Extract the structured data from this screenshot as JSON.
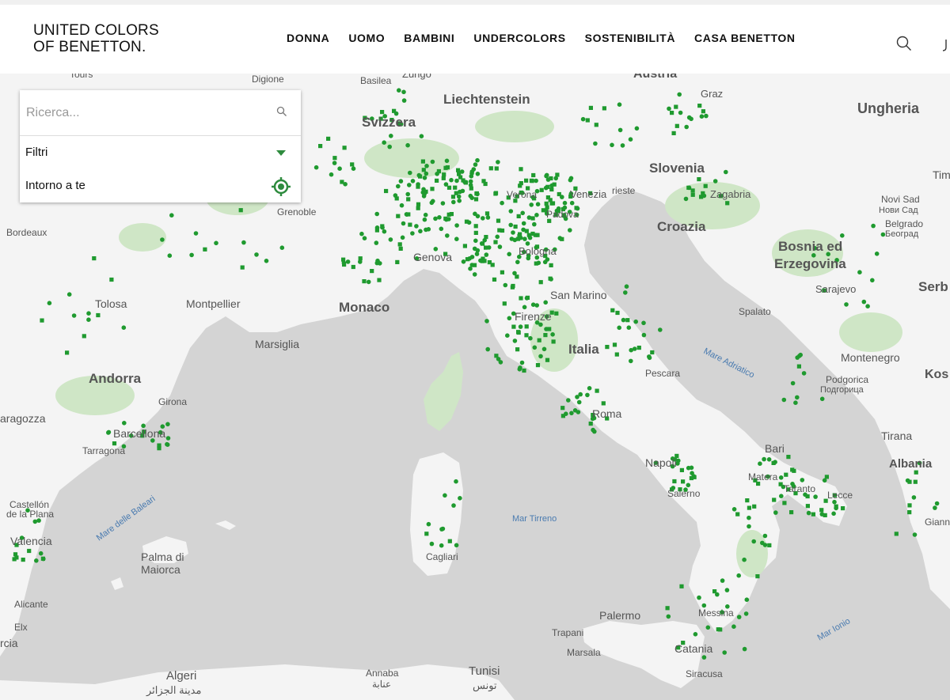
{
  "brand": {
    "line1": "UNITED COLORS",
    "line2": "OF BENETTON."
  },
  "nav": [
    "DONNA",
    "UOMO",
    "BAMBINI",
    "UNDERCOLORS",
    "SOSTENIBILITÀ",
    "CASA BENETTON"
  ],
  "store_locator": {
    "search_placeholder": "Ricerca...",
    "filters_label": "Filtri",
    "nearby_label": "Intorno a te"
  },
  "colors": {
    "accent": "#2e8b3e",
    "store_marker": "#1f9a2f",
    "sea": "#d4d4d4",
    "land": "#f4f4f4",
    "green_area": "#cfe6c6"
  },
  "map_labels": {
    "tours": "Tours",
    "digione": "Digione",
    "basilea": "Basilea",
    "zurigo": "Zurigo",
    "austria": "Austria",
    "liechtenstein": "Liechtenstein",
    "svizzera": "Svizzera",
    "graz": "Graz",
    "ungheria": "Ungheria",
    "slovenia": "Slovenia",
    "zagabria": "Zagabria",
    "novi_sad": "Novi Sad",
    "novi_sad_cyr": "Нови Сад",
    "belgrado": "Belgrado",
    "belgrado_cyr": "Београд",
    "tim": "Tim",
    "grenoble": "Grenoble",
    "bordeaux": "Bordeaux",
    "verona": "Verona",
    "venezia": "Venezia",
    "trieste": "rieste",
    "padova": "Padova",
    "croazia": "Croazia",
    "bosnia1": "Bosnia ed",
    "bosnia2": "Erzegovina",
    "genova": "Genova",
    "sarajevo": "Sarajevo",
    "serbia": "Serb",
    "bologna": "Bologna",
    "tolosa": "Tolosa",
    "montpellier": "Montpellier",
    "monaco": "Monaco",
    "san_marino": "San Marino",
    "firenze": "Firenze",
    "spalato": "Spalato",
    "marsiglia": "Marsiglia",
    "italia": "Italia",
    "mare_adriatico": "Mare Adriatico",
    "montenegro": "Montenegro",
    "kos": "Kos",
    "andorra": "Andorra",
    "podgorica": "Podgorica",
    "podgorica_cyr": "Подгорица",
    "pescara": "Pescara",
    "girona": "Girona",
    "saragozza": "aragozza",
    "roma": "Roma",
    "barcellona": "Barcellona",
    "tirana": "Tirana",
    "bari": "Bari",
    "tarragona": "Tarragona",
    "albania": "Albania",
    "napoli": "Napoli",
    "matera": "Matera",
    "taranto": "Taranto",
    "lecce": "Lecce",
    "mare_baleari": "Mare delle Baleari",
    "castellon1": "Castellón",
    "castellon2": "de la Plana",
    "salerno": "Salerno",
    "mar_tirreno": "Mar Tirreno",
    "giann": "Giann",
    "valencia": "Valencia",
    "palma1": "Palma di",
    "palma2": "Maiorca",
    "cagliari": "Cagliari",
    "alicante": "Alicante",
    "palermo": "Palermo",
    "messina": "Messina",
    "mar_ionio": "Mar Ionio",
    "trapani": "Trapani",
    "elx": "Elx",
    "marsala": "Marsala",
    "catania": "Catania",
    "murcia": "rcia",
    "algeri": "Algeri",
    "algeri_ar": "مدينة الجزائر",
    "annaba": "Annaba",
    "annaba_ar": "عنابة",
    "tunisi": "Tunisi",
    "tunisi_ar": "تونس",
    "siracusa": "Siracusa"
  }
}
